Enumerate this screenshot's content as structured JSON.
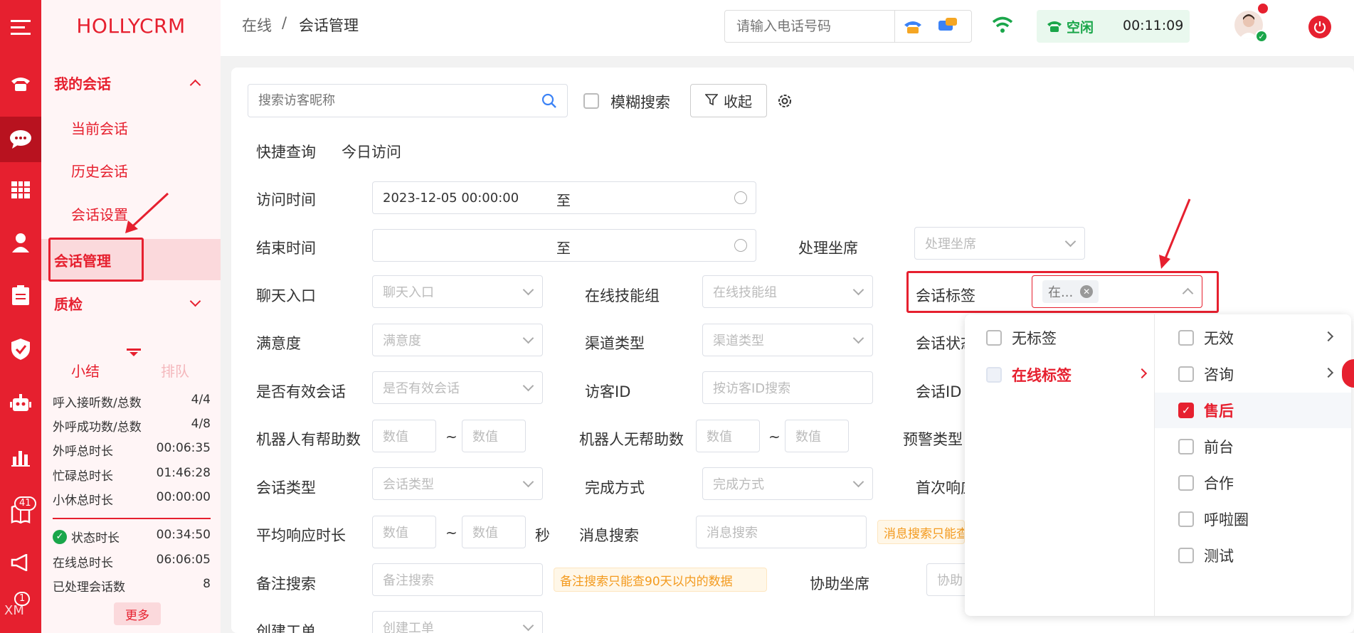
{
  "sidebar": {
    "logo": "HOLLYCRM",
    "group_my_sessions": "我的会话",
    "items": [
      "当前会话",
      "历史会话",
      "会话设置",
      "会话管理"
    ],
    "group_quality": "质检",
    "tabs": {
      "summary": "小结",
      "queue": "排队"
    },
    "stats": [
      {
        "label": "呼入接听数/总数",
        "value": "4/4"
      },
      {
        "label": "外呼成功数/总数",
        "value": "4/8"
      },
      {
        "label": "外呼总时长",
        "value": "00:06:35"
      },
      {
        "label": "忙碌总时长",
        "value": "01:46:28"
      },
      {
        "label": "小休总时长",
        "value": "00:00:00"
      }
    ],
    "stats2": [
      {
        "label": "状态时长",
        "value": "00:34:50"
      },
      {
        "label": "在线总时长",
        "value": "06:06:05"
      },
      {
        "label": "已处理会话数",
        "value": "8"
      }
    ],
    "more_button": "更多"
  },
  "rail": {
    "badge_41": "41",
    "badge_1": "1",
    "xm": "XM"
  },
  "header": {
    "breadcrumb_root": "在线",
    "breadcrumb_sep": "/",
    "breadcrumb_current": "会话管理",
    "phone_placeholder": "请输入电话号码",
    "status": "空闲",
    "timer": "00:11:09"
  },
  "search": {
    "placeholder": "搜索访客昵称",
    "fuzzy_label": "模糊搜索",
    "collapse_button": "收起"
  },
  "quick": {
    "label": "快捷查询",
    "today": "今日访问"
  },
  "form": {
    "visit_time": {
      "label": "访问时间",
      "start": "2023-12-05 00:00:00",
      "to": "至"
    },
    "end_time": {
      "label": "结束时间",
      "to": "至"
    },
    "agent": {
      "label": "处理坐席",
      "placeholder": "处理坐席"
    },
    "entry": {
      "label": "聊天入口",
      "placeholder": "聊天入口"
    },
    "skill_group": {
      "label": "在线技能组",
      "placeholder": "在线技能组"
    },
    "tag": {
      "label": "会话标签",
      "chip": "在..."
    },
    "satisfaction": {
      "label": "满意度",
      "placeholder": "满意度"
    },
    "channel": {
      "label": "渠道类型",
      "placeholder": "渠道类型"
    },
    "session_status": {
      "label": "会话状态"
    },
    "valid": {
      "label": "是否有效会话",
      "placeholder": "是否有效会话"
    },
    "visitor_id": {
      "label": "访客ID",
      "placeholder": "按访客ID搜索"
    },
    "session_id": {
      "label": "会话ID"
    },
    "robot_help": {
      "label": "机器人有帮助数",
      "min": "数值",
      "max": "数值"
    },
    "robot_nohelp": {
      "label": "机器人无帮助数",
      "min": "数值",
      "max": "数值"
    },
    "alert_type": {
      "label": "预警类型"
    },
    "session_type": {
      "label": "会话类型",
      "placeholder": "会话类型"
    },
    "finish_mode": {
      "label": "完成方式",
      "placeholder": "完成方式"
    },
    "first_resp": {
      "label": "首次响应"
    },
    "avg_resp": {
      "label": "平均响应时长",
      "min": "数值",
      "max": "数值",
      "unit": "秒"
    },
    "msg_search": {
      "label": "消息搜索",
      "placeholder": "消息搜索",
      "warn": "消息搜索只能查"
    },
    "note_search": {
      "label": "备注搜索",
      "placeholder": "备注搜索",
      "warn": "备注搜索只能查90天以内的数据"
    },
    "assist": {
      "label": "协助坐席",
      "placeholder": "协助"
    },
    "ticket": {
      "label": "创建工单",
      "placeholder": "创建工单"
    },
    "tilde": "~"
  },
  "tag_dropdown": {
    "left": [
      {
        "label": "无标签",
        "checked": false
      },
      {
        "label": "在线标签",
        "active": true
      }
    ],
    "right": [
      {
        "label": "无效",
        "checked": false,
        "has_children": true
      },
      {
        "label": "咨询",
        "checked": false,
        "has_children": true
      },
      {
        "label": "售后",
        "checked": true,
        "has_children": false
      },
      {
        "label": "前台",
        "checked": false,
        "has_children": false
      },
      {
        "label": "合作",
        "checked": false,
        "has_children": false
      },
      {
        "label": "呼啦圈",
        "checked": false,
        "has_children": false
      },
      {
        "label": "测试",
        "checked": false,
        "has_children": false
      }
    ]
  },
  "colors": {
    "brand": "#e6202f",
    "status_green": "#1aa64a",
    "warn_orange": "#f39a1e"
  }
}
